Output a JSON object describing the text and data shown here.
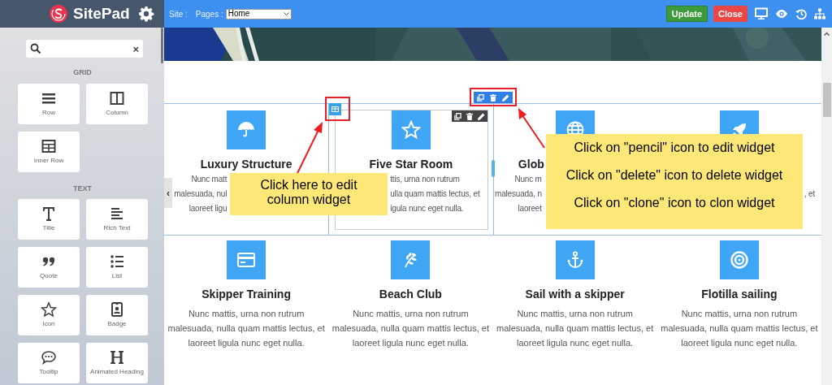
{
  "sidebar": {
    "brand": "SitePad",
    "search": {
      "clear": "×"
    },
    "sections": [
      {
        "title": "GRID",
        "items": [
          "Row",
          "Column",
          "Inner Row"
        ]
      },
      {
        "title": "TEXT",
        "items": [
          "Title",
          "Rich Text",
          "Quote",
          "List",
          "Icon",
          "Badge",
          "Tooltip",
          "Animated Heading"
        ]
      }
    ],
    "collapse": "‹"
  },
  "topbar": {
    "site_label": "Site :",
    "pages_label": "Pages :",
    "page_select": "Home",
    "buttons": [
      {
        "label": "Update",
        "kind": "update"
      },
      {
        "label": "Close",
        "kind": "close"
      }
    ]
  },
  "first_row": [
    {
      "title": "Luxury Structure",
      "lines": [
        "Nunc matt",
        "malesuada, nul",
        "laoreet ligu"
      ]
    },
    {
      "title": "Five Star Room",
      "lines": [
        "ttis, urna non rutrum",
        "ulla quam mattis lectus, et",
        "igula nunc eget nulla."
      ]
    },
    {
      "title": "Glob",
      "lines": [
        "Nunc m",
        "malesuada, n",
        "laoreet"
      ]
    },
    {
      "lines": [
        ", et"
      ]
    }
  ],
  "second_row": [
    {
      "title": "Skipper Training",
      "text": "Nunc mattis, urna non rutrum malesuada, nulla quam mattis lectus, et laoreet ligula nunc eget nulla."
    },
    {
      "title": "Beach Club",
      "text": "Nunc mattis, urna non rutrum malesuada, nulla quam mattis lectus, et laoreet ligula nunc eget nulla."
    },
    {
      "title": "Sail with a skipper",
      "text": "Nunc mattis, urna non rutrum malesuada, nulla quam mattis lectus, et laoreet ligula nunc eget nulla."
    },
    {
      "title": "Flotilla sailing",
      "text": "Nunc mattis, urna non rutrum malesuada, nulla quam mattis lectus, et laoreet ligula nunc eget nulla."
    }
  ],
  "callouts": [
    {
      "lines": [
        "Click here to edit",
        "column widget"
      ]
    },
    {
      "lines": [
        "Click on \"pencil\" icon to edit widget",
        "Click on \"delete\" icon to delete widget",
        "Click on \"clone\" icon to clon widget"
      ]
    }
  ]
}
